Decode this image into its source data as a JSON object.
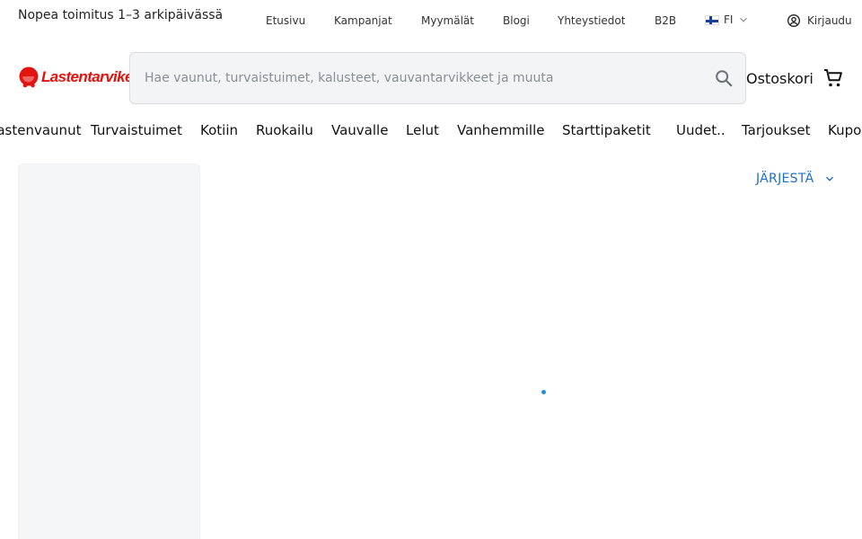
{
  "topbar": {
    "tagline": "Nopea toimitus 1–3 arkipäivässä",
    "links": [
      "Etusivu",
      "Kampanjat",
      "Myymälät",
      "Blogi",
      "Yhteystiedot",
      "B2B"
    ],
    "language": "FI",
    "login": "Kirjaudu"
  },
  "header": {
    "logo_text": "Lastentarvike",
    "search_placeholder": "Hae vaunut, turvaistuimet, kalusteet, vauvantarvikkeet ja muuta",
    "cart_label": "Ostoskori"
  },
  "categories": [
    "Lastenvaunut",
    "Turvaistuimet",
    "Kotiin",
    "Ruokailu",
    "Vauvalle",
    "Lelut",
    "Vanhemmille",
    "Starttipaketit",
    "Uudet..",
    "Tarjoukset",
    "Kupongit"
  ],
  "main": {
    "sort_label": "JÄRJESTÄ"
  },
  "colors": {
    "brand": "#e3140f",
    "link": "#1d6fc4",
    "search_bg": "#f2f4f6"
  }
}
